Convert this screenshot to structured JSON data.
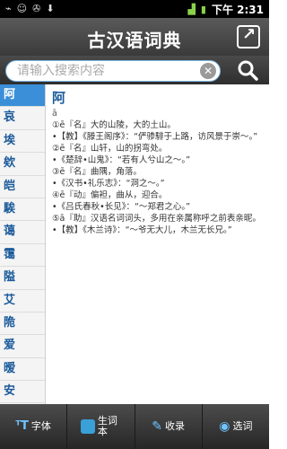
{
  "status_bar": {
    "time": "下午 2:31"
  },
  "header": {
    "title": "古汉语词典"
  },
  "search": {
    "placeholder": "请输入搜索内容"
  },
  "sidebar": {
    "items": [
      "阿",
      "哀",
      "埃",
      "欸",
      "皑",
      "騃",
      "蔼",
      "霭",
      "隘",
      "艾",
      "陒",
      "爱",
      "暧",
      "安",
      "谙"
    ]
  },
  "entry": {
    "headword": "阿",
    "lines": [
      "ā",
      "①ē『名』大的山陵，大的土山。",
      "•【教】《滕王阁序》：“俨骖騑于上路，访风景于崇～。”",
      "②ē『名』山轩，山的拐弯处。",
      "•《楚辞•山鬼》：“若有人兮山之～。”",
      "③ē『名』曲隅，角落。",
      "•《汉书•礼乐志》：“洞之～。”",
      "④ē『动』偏袒，曲从，迎合。",
      "•《吕氏春秋•长见》：“～郑君之心。”",
      "⑤ā『助』汉语名词词头，多用在亲属称呼之前表亲昵。",
      "•【教】《木兰诗》：“～爷无大儿，木兰无长兄。”"
    ]
  },
  "bottom_bar": {
    "tabs": [
      {
        "label": "字体"
      },
      {
        "label": "生词本"
      },
      {
        "label": "收录"
      },
      {
        "label": "选词"
      }
    ]
  }
}
